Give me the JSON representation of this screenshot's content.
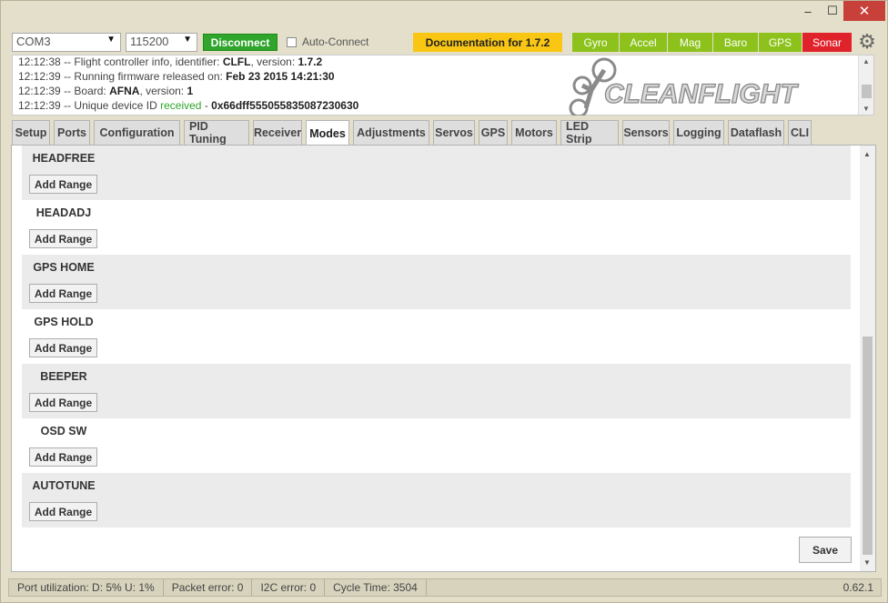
{
  "window": {
    "minimize_glyph": "–",
    "maximize_glyph": "☐",
    "close_glyph": "✕"
  },
  "toolbar": {
    "port": "COM3",
    "baud": "115200",
    "connect_label": "Disconnect",
    "auto_connect_label": "Auto-Connect",
    "docs_label": "Documentation for 1.7.2",
    "sensors": [
      {
        "label": "Gyro",
        "color": "#8cc21b"
      },
      {
        "label": "Accel",
        "color": "#8cc21b"
      },
      {
        "label": "Mag",
        "color": "#8cc21b"
      },
      {
        "label": "Baro",
        "color": "#8cc21b"
      },
      {
        "label": "GPS",
        "color": "#8cc21b"
      },
      {
        "label": "Sonar",
        "color": "#e0222b"
      }
    ]
  },
  "log": {
    "lines": [
      {
        "time": "12:12:38",
        "sep": "--",
        "text": "Flight controller info, identifier: ",
        "b1": "CLFL",
        "mid": ", version: ",
        "b2": "1.7.2"
      },
      {
        "time": "12:12:39",
        "sep": "--",
        "text": "Running firmware released on: ",
        "b1": "Feb 23 2015 14:21:30",
        "mid": "",
        "b2": ""
      },
      {
        "time": "12:12:39",
        "sep": "--",
        "text": "Board: ",
        "b1": "AFNA",
        "mid": ", version: ",
        "b2": "1"
      },
      {
        "time": "12:12:39",
        "sep": "--",
        "text": "Unique device ID ",
        "recv": "received",
        "mid": " - ",
        "b2": "0x66dff555055835087230630"
      }
    ]
  },
  "logo": {
    "text": "CLEANFLIGHT"
  },
  "tabs": [
    "Setup",
    "Ports",
    "Configuration",
    "PID Tuning",
    "Receiver",
    "Modes",
    "Adjustments",
    "Servos",
    "GPS",
    "Motors",
    "LED Strip",
    "Sensors",
    "Logging",
    "Dataflash",
    "CLI"
  ],
  "active_tab": "Modes",
  "modes": [
    {
      "name": "HEADFREE",
      "add_label": "Add Range"
    },
    {
      "name": "HEADADJ",
      "add_label": "Add Range"
    },
    {
      "name": "GPS HOME",
      "add_label": "Add Range"
    },
    {
      "name": "GPS HOLD",
      "add_label": "Add Range"
    },
    {
      "name": "BEEPER",
      "add_label": "Add Range"
    },
    {
      "name": "OSD SW",
      "add_label": "Add Range"
    },
    {
      "name": "AUTOTUNE",
      "add_label": "Add Range"
    }
  ],
  "save_label": "Save",
  "status": {
    "port_util": "Port utilization: D: 5% U: 1%",
    "packet_error": "Packet error: 0",
    "i2c_error": "I2C error: 0",
    "cycle_time": "Cycle Time: 3504",
    "version": "0.62.1"
  }
}
